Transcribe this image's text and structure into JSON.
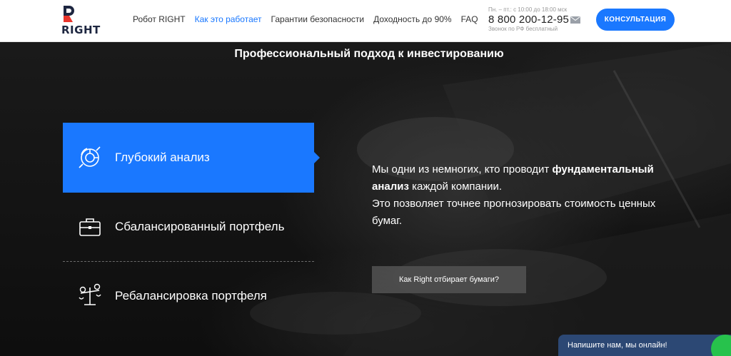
{
  "brand": {
    "logo_text": "RIGHT",
    "accent": "#1a78ff",
    "logo_red": "#e8342b",
    "logo_navy": "#1d2640"
  },
  "nav": [
    {
      "label": "Робот RIGHT",
      "active": false
    },
    {
      "label": "Как это работает",
      "active": true
    },
    {
      "label": "Гарантии безопасности",
      "active": false
    },
    {
      "label": "Доходность до 90%",
      "active": false
    },
    {
      "label": "FAQ",
      "active": false
    }
  ],
  "contact": {
    "hours": "Пн. – пт.: с 10:00 до 18:00 мск",
    "phone": "8 800 200-12-95",
    "note": "Звонок по РФ бесплатный",
    "mail_icon": "mail-icon"
  },
  "consult_button": "КОНСУЛЬТАЦИЯ",
  "hero": {
    "title": "Профессиональный подход к инвестированию",
    "features": [
      {
        "label": "Глубокий анализ",
        "icon": "analysis-chart-icon",
        "active": true
      },
      {
        "label": "Сбалансированный портфель",
        "icon": "briefcase-icon",
        "active": false
      },
      {
        "label": "Ребалансировка портфеля",
        "icon": "scales-icon",
        "active": false
      }
    ],
    "description": {
      "part1": "Мы одни из немногих, кто проводит ",
      "bold": "фундаментальный анализ",
      "part2": " каждой компании.",
      "line2": "Это позволяет точнее прогнозировать стоимость ценных бумаг."
    },
    "how_button": "Как Right отбирает бумаги?"
  },
  "chat": {
    "label": "Напишите нам, мы онлайн!",
    "color": "#2c4874"
  }
}
